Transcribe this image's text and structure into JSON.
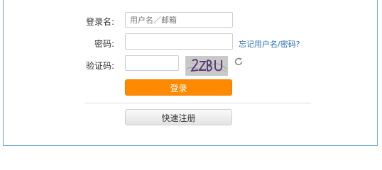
{
  "form": {
    "username_label": "登录名:",
    "username_placeholder": "用户名／邮箱",
    "password_label": "密码:",
    "forgot_link": "忘记用户名/密码?",
    "captcha_label": "验证码:",
    "captcha_text": "2ZBU",
    "login_button": "登录",
    "register_button": "快速注册"
  },
  "colors": {
    "accent": "#ff8a00",
    "link": "#2a6fb0",
    "border": "#6da9d8"
  },
  "icons": {
    "refresh": "refresh-icon"
  }
}
